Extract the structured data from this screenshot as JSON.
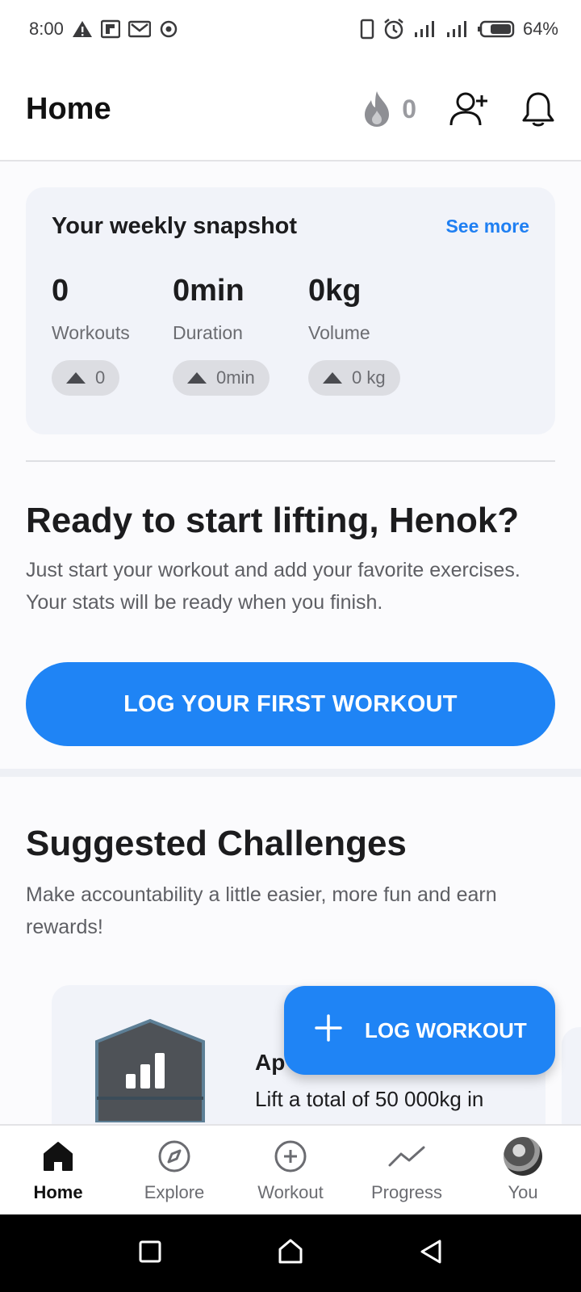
{
  "status_bar": {
    "time": "8:00",
    "battery": "64%",
    "left_icons": [
      "warning-icon",
      "flipboard-icon",
      "gmail-icon",
      "record-icon"
    ],
    "right_icons": [
      "vibrate-icon",
      "alarm-icon",
      "signal-icon",
      "signal-icon",
      "battery-icon"
    ]
  },
  "header": {
    "title": "Home",
    "streak_count": "0",
    "icons": [
      "flame-icon",
      "add-friend-icon",
      "bell-icon"
    ]
  },
  "snapshot": {
    "title": "Your weekly snapshot",
    "see_more": "See more",
    "stats": [
      {
        "value": "0",
        "label": "Workouts",
        "change": "0"
      },
      {
        "value": "0min",
        "label": "Duration",
        "change": "0min"
      },
      {
        "value": "0kg",
        "label": "Volume",
        "change": "0 kg"
      }
    ]
  },
  "ready": {
    "title": "Ready to start lifting, Henok?",
    "subtitle": "Just start your workout and add your favorite exercises. Your stats will be ready when you finish.",
    "button": "LOG YOUR FIRST WORKOUT"
  },
  "challenges": {
    "title": "Suggested Challenges",
    "subtitle": "Make accountability a little easier, more fun and earn rewards!",
    "card": {
      "name_visible": "Ap",
      "description": "Lift a total of 50 000kg in"
    }
  },
  "fab": {
    "label": "LOG WORKOUT"
  },
  "bottom_nav": [
    {
      "label": "Home",
      "icon": "home-icon",
      "active": true
    },
    {
      "label": "Explore",
      "icon": "compass-icon",
      "active": false
    },
    {
      "label": "Workout",
      "icon": "plus-circle-icon",
      "active": false
    },
    {
      "label": "Progress",
      "icon": "trend-icon",
      "active": false
    },
    {
      "label": "You",
      "icon": "avatar",
      "active": false
    }
  ],
  "colors": {
    "accent": "#1f84f5",
    "link": "#1f7ff2",
    "card_bg": "#f1f3f9"
  }
}
